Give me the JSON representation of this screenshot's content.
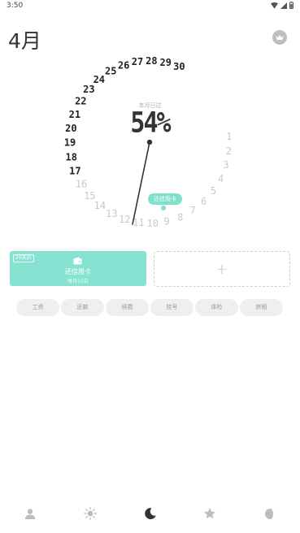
{
  "status_bar": {
    "time": "3:50"
  },
  "header": {
    "month": "4月"
  },
  "dial": {
    "caption": "本月已过",
    "percent": "54%",
    "days": [
      "1",
      "2",
      "3",
      "4",
      "5",
      "6",
      "7",
      "8",
      "9",
      "10",
      "11",
      "12",
      "13",
      "14",
      "15",
      "16",
      "17",
      "18",
      "19",
      "20",
      "21",
      "22",
      "23",
      "24",
      "25",
      "26",
      "27",
      "28",
      "29",
      "30"
    ],
    "today": 17,
    "month_progress": 0.54,
    "past_color": "#222222",
    "future_color": "#c9c9c9",
    "accent_color": "#7fe0cc",
    "tag_label": "还信用卡"
  },
  "cards": {
    "main": {
      "badge": "29天后",
      "title": "还信用卡",
      "subtitle": "每月15日"
    },
    "add": {
      "label": "+"
    }
  },
  "chips": [
    "工资",
    "还款",
    "续费",
    "挂号",
    "体检",
    "房租"
  ],
  "nav": [
    "person-icon",
    "sun-icon",
    "moon-icon",
    "star-icon",
    "theme-icon"
  ]
}
